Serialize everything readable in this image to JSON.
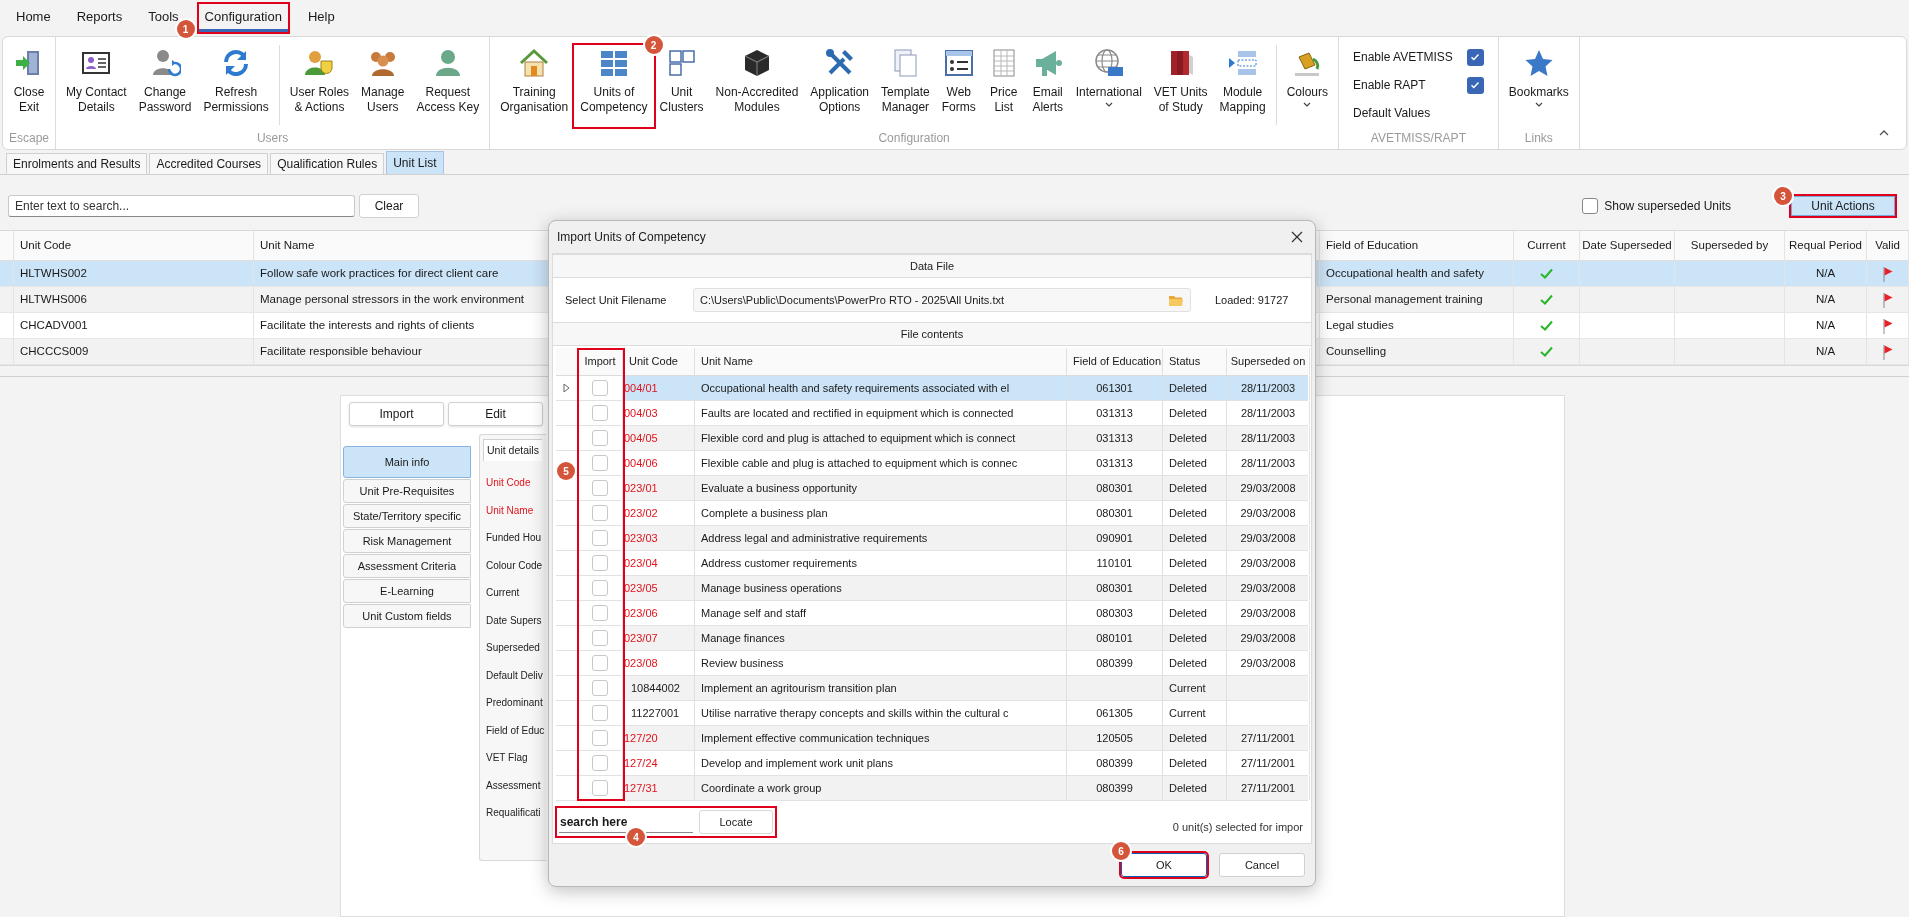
{
  "menu": [
    {
      "label": "Home",
      "selected": false
    },
    {
      "label": "Reports",
      "selected": false
    },
    {
      "label": "Tools",
      "selected": false
    },
    {
      "label": "Configuration",
      "selected": true,
      "callout": "1"
    },
    {
      "label": "Help",
      "selected": false
    }
  ],
  "ribbon": {
    "groups": [
      {
        "label": "Escape",
        "sets": [
          [
            {
              "lines": [
                "Close",
                "Exit"
              ]
            }
          ]
        ]
      },
      {
        "label": "Users",
        "sets": [
          [
            {
              "lines": [
                "My Contact",
                "Details"
              ]
            },
            {
              "lines": [
                "Change",
                "Password"
              ]
            },
            {
              "lines": [
                "Refresh",
                "Permissions"
              ]
            }
          ],
          [
            {
              "lines": [
                "User Roles",
                "& Actions"
              ]
            },
            {
              "lines": [
                "Manage",
                "Users"
              ]
            },
            {
              "lines": [
                "Request",
                "Access Key"
              ]
            }
          ]
        ]
      },
      {
        "label": "Configuration",
        "sets": [
          [
            {
              "lines": [
                "Training",
                "Organisation"
              ]
            },
            {
              "lines": [
                "Units of",
                "Competency"
              ],
              "callout": "2"
            },
            {
              "lines": [
                "Unit",
                "Clusters"
              ]
            },
            {
              "lines": [
                "Non-Accredited",
                "Modules"
              ]
            },
            {
              "lines": [
                "Application",
                "Options"
              ]
            },
            {
              "lines": [
                "Template",
                "Manager"
              ]
            },
            {
              "lines": [
                "Web",
                "Forms"
              ]
            },
            {
              "lines": [
                "Price",
                "List"
              ]
            },
            {
              "lines": [
                "Email",
                "Alerts"
              ]
            },
            {
              "lines": [
                "International"
              ],
              "dropdown": true
            },
            {
              "lines": [
                "VET Units",
                "of Study"
              ]
            },
            {
              "lines": [
                "Module",
                "Mapping"
              ]
            }
          ],
          [
            {
              "lines": [
                "Colours"
              ],
              "dropdown": true
            }
          ]
        ]
      },
      {
        "label": "AVETMISS/RAPT",
        "options": [
          {
            "kind": "checkbox",
            "label": "Enable AVETMISS",
            "checked": true
          },
          {
            "kind": "checkbox",
            "label": "Enable RAPT",
            "checked": true
          },
          {
            "kind": "link",
            "label": "Default Values"
          }
        ]
      },
      {
        "label": "Links",
        "sets": [
          [
            {
              "lines": [
                "Bookmarks"
              ],
              "dropdown": true
            }
          ]
        ]
      }
    ]
  },
  "doc_tabs": [
    {
      "label": "Enrolments and Results",
      "selected": false
    },
    {
      "label": "Accredited Courses",
      "selected": false
    },
    {
      "label": "Qualification Rules",
      "selected": false
    },
    {
      "label": "Unit List",
      "selected": true
    }
  ],
  "search": {
    "placeholder": "Enter text to search...",
    "clear_button": "Clear"
  },
  "show_superseded": {
    "label": "Show superseded Units",
    "checked": false
  },
  "unit_actions": {
    "label": "Unit Actions",
    "callout": "3"
  },
  "units_table": {
    "columns": [
      "Unit Code",
      "Unit Name",
      "Field of Education",
      "Current",
      "Date Superseded",
      "Superseded by",
      "Requal Period",
      "Valid"
    ],
    "rows": [
      {
        "selected": true,
        "unit_code": "HLTWHS002",
        "unit_name": "Follow safe work practices for direct client care",
        "field_of_education": "Occupational health and safety",
        "current": true,
        "requal_period": "N/A",
        "flagged": true
      },
      {
        "selected": false,
        "unit_code": "HLTWHS006",
        "unit_name": "Manage personal stressors in the work environment",
        "field_of_education": "Personal management training",
        "current": true,
        "requal_period": "N/A",
        "flagged": true
      },
      {
        "selected": false,
        "unit_code": "CHCADV001",
        "unit_name": "Facilitate the interests and rights of clients",
        "field_of_education": "Legal studies",
        "current": true,
        "requal_period": "N/A",
        "flagged": true
      },
      {
        "selected": false,
        "unit_code": "CHCCCS009",
        "unit_name": "Facilitate responsible behaviour",
        "field_of_education": "Counselling",
        "current": true,
        "requal_period": "N/A",
        "flagged": true
      }
    ]
  },
  "detail": {
    "buttons": [
      "Import",
      "Edit"
    ],
    "side_tabs": [
      {
        "label": "Main info",
        "selected": true
      },
      {
        "label": "Unit Pre-Requisites",
        "selected": false
      },
      {
        "label": "State/Territory specific",
        "selected": false
      },
      {
        "label": "Risk Management",
        "selected": false
      },
      {
        "label": "Assessment Criteria",
        "selected": false
      },
      {
        "label": "E-Learning",
        "selected": false
      },
      {
        "label": "Unit Custom fields",
        "selected": false
      }
    ],
    "section_tab": "Unit details",
    "fields": [
      {
        "label": "Unit Code",
        "required": true
      },
      {
        "label": "Unit Name",
        "required": true
      },
      {
        "label": "Funded Hou",
        "required": false
      },
      {
        "label": "Colour Code",
        "required": false
      },
      {
        "label": "Current",
        "required": false
      },
      {
        "label": "Date Supers",
        "required": false
      },
      {
        "label": "Superseded",
        "required": false
      },
      {
        "label": "Default Deliv",
        "required": false
      },
      {
        "label": "Predominant",
        "required": false
      },
      {
        "label": "Field of Educ",
        "required": false
      },
      {
        "label": "VET Flag",
        "required": false
      },
      {
        "label": "Assessment",
        "required": false
      },
      {
        "label": "Requalificati",
        "required": false
      }
    ]
  },
  "dialog": {
    "title": "Import Units of Competency",
    "data_file_header": "Data File",
    "filename_label": "Select Unit Filename",
    "filename": "C:\\Users\\Public\\Documents\\PowerPro RTO - 2025\\All Units.txt",
    "loaded": "Loaded: 91727",
    "contents_header": "File contents",
    "columns": [
      {
        "label": "Import",
        "callout": "5"
      },
      {
        "label": "Unit Code"
      },
      {
        "label": "Unit Name"
      },
      {
        "label": "Field of Education"
      },
      {
        "label": "Status"
      },
      {
        "label": "Superseded on"
      }
    ],
    "rows": [
      {
        "selected": true,
        "import": false,
        "obsolete": true,
        "unit_code": "004/01",
        "unit_name": "Occupational health and safety requirements associated with el",
        "field_of_education": "061301",
        "status": "Deleted",
        "superseded_on": "28/11/2003"
      },
      {
        "selected": false,
        "import": false,
        "obsolete": true,
        "unit_code": "004/03",
        "unit_name": "Faults are located and rectified in equipment which is connected",
        "field_of_education": "031313",
        "status": "Deleted",
        "superseded_on": "28/11/2003"
      },
      {
        "selected": false,
        "import": false,
        "obsolete": true,
        "unit_code": "004/05",
        "unit_name": "Flexible cord and plug is attached to equipment which is connect",
        "field_of_education": "031313",
        "status": "Deleted",
        "superseded_on": "28/11/2003"
      },
      {
        "selected": false,
        "import": false,
        "obsolete": true,
        "unit_code": "004/06",
        "unit_name": "Flexible cable and plug is attached to equipment which is connec",
        "field_of_education": "031313",
        "status": "Deleted",
        "superseded_on": "28/11/2003"
      },
      {
        "selected": false,
        "import": false,
        "obsolete": true,
        "unit_code": "023/01",
        "unit_name": "Evaluate a business opportunity",
        "field_of_education": "080301",
        "status": "Deleted",
        "superseded_on": "29/03/2008"
      },
      {
        "selected": false,
        "import": false,
        "obsolete": true,
        "unit_code": "023/02",
        "unit_name": "Complete a business plan",
        "field_of_education": "080301",
        "status": "Deleted",
        "superseded_on": "29/03/2008"
      },
      {
        "selected": false,
        "import": false,
        "obsolete": true,
        "unit_code": "023/03",
        "unit_name": "Address legal and administrative requirements",
        "field_of_education": "090901",
        "status": "Deleted",
        "superseded_on": "29/03/2008"
      },
      {
        "selected": false,
        "import": false,
        "obsolete": true,
        "unit_code": "023/04",
        "unit_name": "Address customer requirements",
        "field_of_education": "110101",
        "status": "Deleted",
        "superseded_on": "29/03/2008"
      },
      {
        "selected": false,
        "import": false,
        "obsolete": true,
        "unit_code": "023/05",
        "unit_name": "Manage business operations",
        "field_of_education": "080301",
        "status": "Deleted",
        "superseded_on": "29/03/2008"
      },
      {
        "selected": false,
        "import": false,
        "obsolete": true,
        "unit_code": "023/06",
        "unit_name": "Manage self and staff",
        "field_of_education": "080303",
        "status": "Deleted",
        "superseded_on": "29/03/2008"
      },
      {
        "selected": false,
        "import": false,
        "obsolete": true,
        "unit_code": "023/07",
        "unit_name": "Manage finances",
        "field_of_education": "080101",
        "status": "Deleted",
        "superseded_on": "29/03/2008"
      },
      {
        "selected": false,
        "import": false,
        "obsolete": true,
        "unit_code": "023/08",
        "unit_name": "Review business",
        "field_of_education": "080399",
        "status": "Deleted",
        "superseded_on": "29/03/2008"
      },
      {
        "selected": false,
        "import": false,
        "obsolete": false,
        "unit_code": "10844002",
        "unit_name": "Implement an agritourism transition plan",
        "status": "Current"
      },
      {
        "selected": false,
        "import": false,
        "obsolete": false,
        "unit_code": "11227001",
        "unit_name": "Utilise narrative therapy concepts and skills within the cultural c",
        "field_of_education": "061305",
        "status": "Current"
      },
      {
        "selected": false,
        "import": false,
        "obsolete": true,
        "unit_code": "127/20",
        "unit_name": "Implement effective communication techniques",
        "field_of_education": "120505",
        "status": "Deleted",
        "superseded_on": "27/11/2001"
      },
      {
        "selected": false,
        "import": false,
        "obsolete": true,
        "unit_code": "127/24",
        "unit_name": "Develop and implement work unit plans",
        "field_of_education": "080399",
        "status": "Deleted",
        "superseded_on": "27/11/2001"
      },
      {
        "selected": false,
        "import": false,
        "obsolete": true,
        "unit_code": "127/31",
        "unit_name": "Coordinate a work group",
        "field_of_education": "080399",
        "status": "Deleted",
        "superseded_on": "27/11/2001"
      }
    ],
    "locate": {
      "search_value": "search here",
      "button": "Locate",
      "callout": "4"
    },
    "selection_count": "0 unit(s) selected for impor",
    "ok": {
      "label": "OK",
      "callout": "6"
    },
    "cancel": "Cancel"
  }
}
